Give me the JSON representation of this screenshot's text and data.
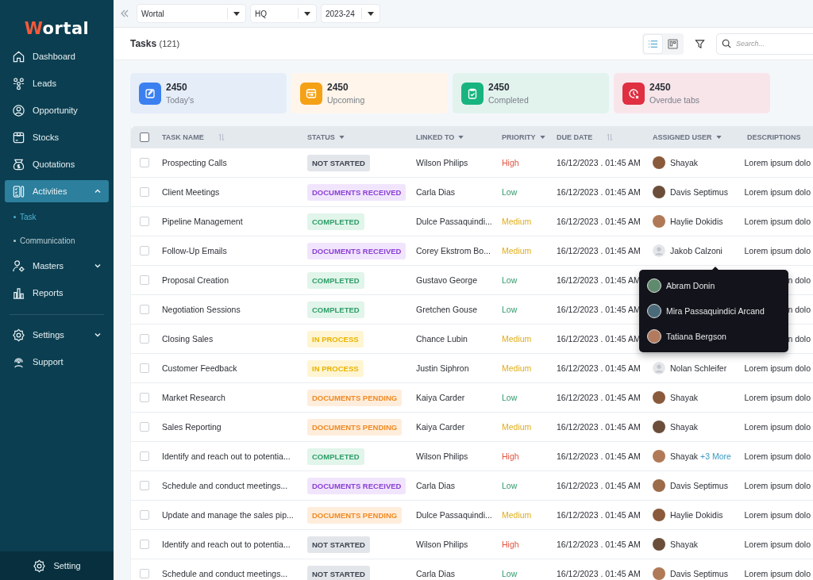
{
  "sidebar": {
    "logo": "Wortal",
    "main_items": [
      {
        "label": "Dashboard",
        "selected": false
      },
      {
        "label": "Leads",
        "selected": false
      },
      {
        "label": "Opportunity",
        "selected": false
      },
      {
        "label": "Stocks",
        "selected": false
      },
      {
        "label": "Quotations",
        "selected": false
      },
      {
        "label": "Activities",
        "selected": true,
        "expanded": true,
        "children": [
          {
            "label": "Task",
            "selected": true
          },
          {
            "label": "Communication",
            "selected": false
          }
        ]
      },
      {
        "label": "Masters",
        "selected": false,
        "expanded": false
      },
      {
        "label": "Reports",
        "selected": false
      }
    ],
    "secondary_items": [
      {
        "label": "Settings",
        "selected": false,
        "expanded": false
      },
      {
        "label": "Support",
        "selected": false
      }
    ],
    "footer": "Setting"
  },
  "top_bar": {
    "selects": [
      "Wortal",
      "HQ",
      "2023-24"
    ]
  },
  "header": {
    "title": "Tasks",
    "count": "(121)",
    "views": [
      {
        "kind": "list",
        "selected": true
      },
      {
        "kind": "board",
        "selected": false
      }
    ],
    "search": {
      "placeholder": "Search..."
    }
  },
  "stats": [
    {
      "kind": "today",
      "value": "2450",
      "label": "Today's"
    },
    {
      "kind": "upcoming",
      "value": "2450",
      "label": "Upcoming"
    },
    {
      "kind": "completed",
      "value": "2450",
      "label": "Completed"
    },
    {
      "kind": "overdue",
      "value": "2450",
      "label": "Overdue tabs"
    }
  ],
  "table": {
    "all_checked": false,
    "columns": [
      {
        "label": "TASK NAME",
        "sortable": true,
        "filterable": false
      },
      {
        "label": "STATUS",
        "sortable": false,
        "filterable": true
      },
      {
        "label": "LINKED TO",
        "sortable": false,
        "filterable": true
      },
      {
        "label": "PRIORITY",
        "sortable": false,
        "filterable": true
      },
      {
        "label": "DUE DATE",
        "sortable": true,
        "filterable": false
      },
      {
        "label": "ASSIGNED USER",
        "sortable": false,
        "filterable": true
      },
      {
        "label": "DESCRIPTIONS",
        "sortable": false,
        "filterable": false
      }
    ],
    "rows": [
      {
        "checked": false,
        "task": "Prospecting Calls",
        "status": {
          "label": "NOT STARTED",
          "kind": "not_started"
        },
        "linked_to": "Wilson Philips",
        "priority": {
          "label": "High",
          "kind": "high"
        },
        "due": "16/12/2023 . 01:45 AM",
        "user": {
          "name": "Shayak",
          "has_photo": true
        },
        "description": "Lorem ipsum dolo"
      },
      {
        "checked": false,
        "task": "Client Meetings",
        "status": {
          "label": "DOCUMENTS RECEIVED",
          "kind": "received"
        },
        "linked_to": "Carla Dias",
        "priority": {
          "label": "Low",
          "kind": "low"
        },
        "due": "16/12/2023 . 01:45 AM",
        "user": {
          "name": "Davis Septimus",
          "has_photo": true
        },
        "description": "Lorem ipsum dolo"
      },
      {
        "checked": false,
        "task": "Pipeline Management",
        "status": {
          "label": "COMPLETED",
          "kind": "completed"
        },
        "linked_to": "Dulce Passaquindi...",
        "priority": {
          "label": "Medium",
          "kind": "medium"
        },
        "due": "16/12/2023 . 01:45 AM",
        "user": {
          "name": "Haylie Dokidis",
          "has_photo": true
        },
        "description": "Lorem ipsum dolo"
      },
      {
        "checked": false,
        "task": "Follow-Up Emails",
        "status": {
          "label": "DOCUMENTS RECEIVED",
          "kind": "received"
        },
        "linked_to": "Corey Ekstrom Bo...",
        "priority": {
          "label": "Medium",
          "kind": "medium"
        },
        "due": "16/12/2023 . 01:45 AM",
        "user": {
          "name": "Jakob Calzoni",
          "has_photo": false
        },
        "description": "Lorem ipsum dolo"
      },
      {
        "checked": false,
        "task": "Proposal Creation",
        "status": {
          "label": "COMPLETED",
          "kind": "completed"
        },
        "linked_to": "Gustavo George",
        "priority": {
          "label": "Low",
          "kind": "low"
        },
        "due": "16/12/2023 . 01:45 AM",
        "description": "n dolo"
      },
      {
        "checked": false,
        "task": "Negotiation Sessions",
        "status": {
          "label": "COMPLETED",
          "kind": "completed"
        },
        "linked_to": "Gretchen Gouse",
        "priority": {
          "label": "Low",
          "kind": "low"
        },
        "due": "16/12/2023 . 01:45 AM",
        "description": "n dolo"
      },
      {
        "checked": false,
        "task": "Closing Sales",
        "status": {
          "label": "IN PROCESS",
          "kind": "in_process"
        },
        "linked_to": "Chance Lubin",
        "priority": {
          "label": "Medium",
          "kind": "medium"
        },
        "due": "16/12/2023 . 01:45 AM",
        "description": "n dolo"
      },
      {
        "checked": false,
        "task": "Customer Feedback",
        "status": {
          "label": "IN PROCESS",
          "kind": "in_process"
        },
        "linked_to": "Justin Siphron",
        "priority": {
          "label": "Medium",
          "kind": "medium"
        },
        "due": "16/12/2023 . 01:45 AM",
        "user": {
          "name": "Nolan Schleifer",
          "has_photo": false
        },
        "description": "Lorem ipsum dolo"
      },
      {
        "checked": false,
        "task": "Market Research",
        "status": {
          "label": "DOCUMENTS PENDING",
          "kind": "pending"
        },
        "linked_to": "Kaiya Carder",
        "priority": {
          "label": "Low",
          "kind": "low"
        },
        "due": "16/12/2023 . 01:45 AM",
        "user": {
          "name": "Shayak",
          "has_photo": true
        },
        "description": "Lorem ipsum dolo"
      },
      {
        "checked": false,
        "task": "Sales Reporting",
        "status": {
          "label": "DOCUMENTS PENDING",
          "kind": "pending"
        },
        "linked_to": "Kaiya Carder",
        "priority": {
          "label": "Medium",
          "kind": "medium"
        },
        "due": "16/12/2023 . 01:45 AM",
        "user": {
          "name": "Shayak",
          "has_photo": true
        },
        "description": "Lorem ipsum dolo"
      },
      {
        "checked": false,
        "task": "Identify and reach out to potentia...",
        "status": {
          "label": "COMPLETED",
          "kind": "completed"
        },
        "linked_to": "Wilson Philips",
        "priority": {
          "label": "High",
          "kind": "high"
        },
        "due": "16/12/2023 . 01:45 AM",
        "user": {
          "name": "Shayak",
          "has_photo": true,
          "more": "+3 More"
        },
        "description": "Lorem ipsum dolo"
      },
      {
        "checked": false,
        "task": "Schedule and conduct meetings...",
        "status": {
          "label": "DOCUMENTS RECEIVED",
          "kind": "received"
        },
        "linked_to": "Carla Dias",
        "priority": {
          "label": "Low",
          "kind": "low"
        },
        "due": "16/12/2023 . 01:45 AM",
        "user": {
          "name": "Davis Septimus",
          "has_photo": true
        },
        "description": "Lorem ipsum dolo"
      },
      {
        "checked": false,
        "task": "Update and manage the sales pip...",
        "status": {
          "label": "DOCUMENTS PENDING",
          "kind": "pending"
        },
        "linked_to": "Dulce Passaquindi...",
        "priority": {
          "label": "Medium",
          "kind": "medium"
        },
        "due": "16/12/2023 . 01:45 AM",
        "user": {
          "name": "Haylie Dokidis",
          "has_photo": true
        },
        "description": "Lorem ipsum dolo"
      },
      {
        "checked": false,
        "task": "Identify and reach out to potentia...",
        "status": {
          "label": "NOT STARTED",
          "kind": "not_started"
        },
        "linked_to": "Wilson Philips",
        "priority": {
          "label": "High",
          "kind": "high"
        },
        "due": "16/12/2023 . 01:45 AM",
        "user": {
          "name": "Shayak",
          "has_photo": true
        },
        "description": "Lorem ipsum dolo"
      },
      {
        "checked": false,
        "task": "Schedule and conduct meetings...",
        "status": {
          "label": "NOT STARTED",
          "kind": "not_started"
        },
        "linked_to": "Carla Dias",
        "priority": {
          "label": "Low",
          "kind": "low"
        },
        "due": "16/12/2023 . 01:45 AM",
        "user": {
          "name": "Davis Septimus",
          "has_photo": true
        },
        "description": "Lorem ipsum dolo"
      }
    ],
    "user_popover": [
      {
        "name": "Abram Donin"
      },
      {
        "name": "Mira Passaquindici Arcand"
      },
      {
        "name": "Tatiana Bergson"
      }
    ]
  }
}
